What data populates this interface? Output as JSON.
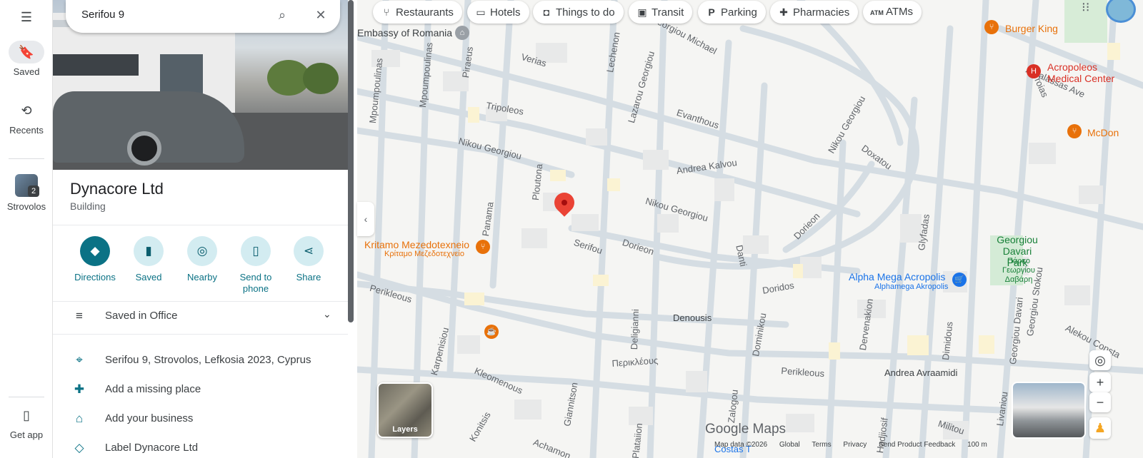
{
  "rail": {
    "saved": "Saved",
    "recents": "Recents",
    "strovolos": "Strovolos",
    "strovolos_count": "2",
    "get_app": "Get app"
  },
  "search": {
    "value": "Serifou 9"
  },
  "place": {
    "title": "Dynacore Ltd",
    "type": "Building"
  },
  "actions": [
    {
      "label": "Directions"
    },
    {
      "label": "Saved"
    },
    {
      "label": "Nearby"
    },
    {
      "label": "Send to phone"
    },
    {
      "label": "Share"
    }
  ],
  "saved_list": "Saved in Office",
  "details": {
    "address": "Serifou 9, Strovolos, Lefkosia 2023, Cyprus",
    "add_place": "Add a missing place",
    "add_business": "Add your business",
    "add_label": "Label Dynacore Ltd"
  },
  "chips": [
    "Restaurants",
    "Hotels",
    "Things to do",
    "Transit",
    "Parking",
    "Pharmacies",
    "ATMs"
  ],
  "map": {
    "streets": [
      "Embassy of Romania",
      "Verias",
      "Piraeus",
      "Mpoumpoulinas",
      "Mpoumpoulinas",
      "Lechenon",
      "Georgiou Michael",
      "Tripoleos",
      "Lazarou Georgiou",
      "Evanthous",
      "Nikou Georgiou",
      "Ploutona",
      "Andrea Kalvou",
      "Nikou Georgiou",
      "Panama",
      "Nikou Georgiou",
      "Doxatou",
      "Glyfadas",
      "Serifou",
      "Dorieon",
      "Dorieon",
      "Danti",
      "Perikleous",
      "Doridos",
      "Denousis",
      "Deligianni",
      "Dominikou",
      "Dervenakion",
      "Karpenisiou",
      "Kleomenous",
      "Giannitson",
      "Zalogou",
      "Περικλέους",
      "Perikleous",
      "Andrea Avraamidi",
      "Athalassas Ave",
      "Troias",
      "Georgiou Davari",
      "Dimidous",
      "Georgiou Stokou",
      "Alekou Consta",
      "Militou",
      "Livaniou",
      "Achamon",
      "Konitsis",
      "Plataiion",
      "Hadjiosif",
      "Costas T"
    ],
    "pois": {
      "burger_king": "Burger King",
      "acropoleos": "Acropoleos Medical Center",
      "mcdonalds": "McDon",
      "kritamo": "Kritamo Mezedotexneio",
      "kritamo_gr": "Κρίταμο Μεζεδοτεχνείο",
      "park": "Georgiou Davari Park",
      "park_gr": "Πάρκο Γεωργίου Δαβάρη",
      "alpha": "Alpha Mega Acropolis",
      "alpha_sub": "Alphamega Akropolis"
    },
    "layers": "Layers",
    "logo": "Google Maps",
    "footer": [
      "Map data ©2026",
      "Global",
      "Terms",
      "Privacy",
      "Send Product Feedback",
      "100 m"
    ]
  },
  "colors": {
    "accent": "#0b7285",
    "pin": "#ea4335",
    "poi_orange": "#e8710a",
    "poi_red": "#d93025",
    "poi_blue": "#1a73e8"
  }
}
